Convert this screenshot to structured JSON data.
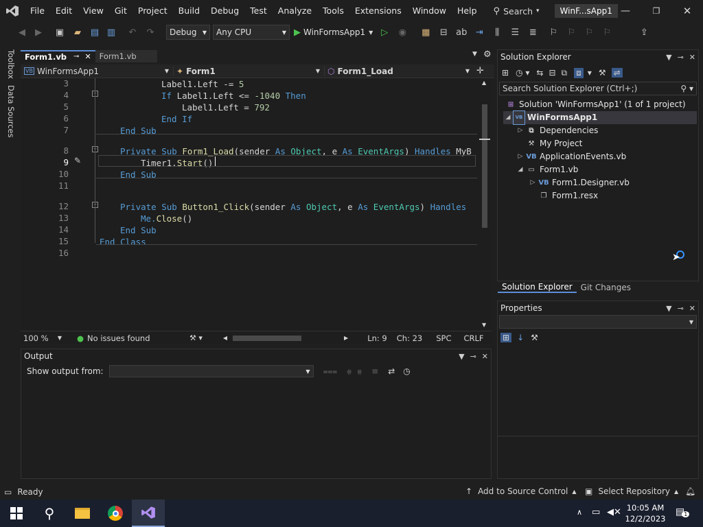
{
  "menubar": {
    "items": [
      "File",
      "Edit",
      "View",
      "Git",
      "Project",
      "Build",
      "Debug",
      "Test",
      "Analyze",
      "Tools",
      "Extensions",
      "Window",
      "Help"
    ],
    "search_label": "Search",
    "window_title": "WinF...sApp1"
  },
  "toolbar": {
    "config": "Debug",
    "platform": "Any CPU",
    "start_label": "WinFormsApp1"
  },
  "side_tabs": [
    "Toolbox",
    "Data Sources"
  ],
  "editor": {
    "tabs": [
      {
        "label": "Form1.vb",
        "active": true
      },
      {
        "label": "Form1.vb",
        "active": false
      }
    ],
    "nav_project": "WinFormsApp1",
    "nav_class": "Form1",
    "nav_member": "Form1_Load",
    "line_numbers": [
      "3",
      "4",
      "5",
      "6",
      "7",
      "8",
      "9",
      "10",
      "11",
      "12",
      "13",
      "14",
      "15",
      "16"
    ],
    "lines": [
      [
        {
          "t": "Label1.Left -= ",
          "c": "id"
        },
        {
          "t": "5",
          "c": "num"
        }
      ],
      [
        {
          "t": "If ",
          "c": "kw"
        },
        {
          "t": "Label1.Left <= ",
          "c": "id"
        },
        {
          "t": "-1040",
          "c": "num"
        },
        {
          "t": " Then",
          "c": "kw"
        }
      ],
      [
        {
          "t": "Label1.Left = ",
          "c": "id"
        },
        {
          "t": "792",
          "c": "num"
        }
      ],
      [
        {
          "t": "End If",
          "c": "kw"
        }
      ],
      [
        {
          "t": "End Sub",
          "c": "kw"
        }
      ],
      [
        {
          "t": "Private Sub ",
          "c": "kw"
        },
        {
          "t": "Form1_Load",
          "c": "fn"
        },
        {
          "t": "(sender ",
          "c": "id"
        },
        {
          "t": "As ",
          "c": "kw"
        },
        {
          "t": "Object",
          "c": "ty"
        },
        {
          "t": ", e ",
          "c": "id"
        },
        {
          "t": "As ",
          "c": "kw"
        },
        {
          "t": "EventArgs",
          "c": "ty"
        },
        {
          "t": ") ",
          "c": "id"
        },
        {
          "t": "Handles ",
          "c": "kw"
        },
        {
          "t": "MyB",
          "c": "id"
        }
      ],
      [
        {
          "t": "Timer1.",
          "c": "id"
        },
        {
          "t": "Start",
          "c": "fn"
        },
        {
          "t": "()",
          "c": "id"
        }
      ],
      [
        {
          "t": "End Sub",
          "c": "kw"
        }
      ],
      [],
      [
        {
          "t": "Private Sub ",
          "c": "kw"
        },
        {
          "t": "Button1_Click",
          "c": "fn"
        },
        {
          "t": "(sender ",
          "c": "id"
        },
        {
          "t": "As ",
          "c": "kw"
        },
        {
          "t": "Object",
          "c": "ty"
        },
        {
          "t": ", e ",
          "c": "id"
        },
        {
          "t": "As ",
          "c": "kw"
        },
        {
          "t": "EventArgs",
          "c": "ty"
        },
        {
          "t": ") ",
          "c": "id"
        },
        {
          "t": "Handles",
          "c": "kw"
        }
      ],
      [
        {
          "t": "Me.",
          "c": "kw"
        },
        {
          "t": "Close",
          "c": "fn"
        },
        {
          "t": "()",
          "c": "id"
        }
      ],
      [
        {
          "t": "End Sub",
          "c": "kw"
        }
      ],
      [
        {
          "t": "End Class",
          "c": "kw"
        }
      ],
      []
    ],
    "zoom": "100 %",
    "issues": "No issues found",
    "ln": "Ln: 9",
    "ch": "Ch: 23",
    "spc": "SPC",
    "crlf": "CRLF"
  },
  "output": {
    "title": "Output",
    "show_from": "Show output from:"
  },
  "solution_explorer": {
    "title": "Solution Explorer",
    "search_placeholder": "Search Solution Explorer (Ctrl+;)",
    "solution": "Solution 'WinFormsApp1' (1 of 1 project)",
    "project": "WinFormsApp1",
    "items": [
      "Dependencies",
      "My Project",
      "ApplicationEvents.vb",
      "Form1.vb",
      "Form1.Designer.vb",
      "Form1.resx"
    ],
    "bottom_tabs": [
      "Solution Explorer",
      "Git Changes"
    ]
  },
  "properties": {
    "title": "Properties"
  },
  "statusbar": {
    "ready": "Ready",
    "add_source": "Add to Source Control",
    "select_repo": "Select Repository"
  },
  "taskbar": {
    "time": "10:05 AM",
    "date": "12/2/2023",
    "notif_count": "1"
  }
}
